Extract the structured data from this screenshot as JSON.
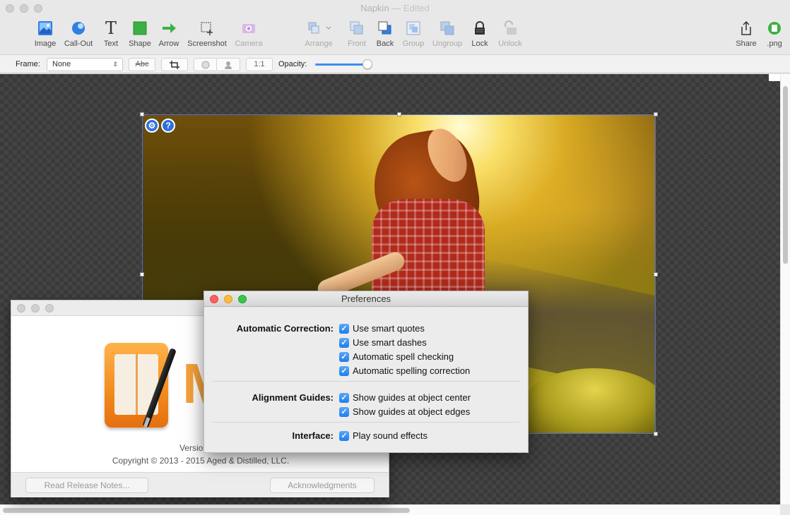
{
  "window": {
    "title": "Napkin",
    "separator": "—",
    "status": "Edited"
  },
  "toolbar": {
    "image": "Image",
    "callout": "Call-Out",
    "text": "Text",
    "shape": "Shape",
    "arrow": "Arrow",
    "screenshot": "Screenshot",
    "camera": "Camera",
    "arrange": "Arrange",
    "front": "Front",
    "back": "Back",
    "group": "Group",
    "ungroup": "Ungroup",
    "lock": "Lock",
    "unlock": "Unlock",
    "share": "Share",
    "png": ".png",
    "text_glyph": "T"
  },
  "formatbar": {
    "frame_label": "Frame:",
    "frame_value": "None",
    "text_style_btn": "Abc",
    "ratio_btn": "1:1",
    "opacity_label": "Opacity:",
    "opacity_value": 1.0
  },
  "canvas": {
    "settings_btn": "⚙",
    "help_btn": "?"
  },
  "about": {
    "logo_letter": "M",
    "version": "Version 1.5",
    "copyright": "Copyright © 2013 - 2015 Aged & Distilled, LLC.",
    "release_notes_btn": "Read Release Notes...",
    "acknowledgments_btn": "Acknowledgments"
  },
  "preferences": {
    "title": "Preferences",
    "groups": [
      {
        "label": "Automatic Correction:",
        "options": [
          "Use smart quotes",
          "Use smart dashes",
          "Automatic spell checking",
          "Automatic spelling correction"
        ]
      },
      {
        "label": "Alignment Guides:",
        "options": [
          "Show guides at object center",
          "Show guides at object edges"
        ]
      },
      {
        "label": "Interface:",
        "options": [
          "Play sound effects"
        ]
      }
    ],
    "checked_glyph": "✓"
  },
  "colors": {
    "accent": "#1d7ef0",
    "selection": "#4a6fd8",
    "close": "#fc605c",
    "minimize": "#fdbc40",
    "zoom": "#34c84a"
  }
}
